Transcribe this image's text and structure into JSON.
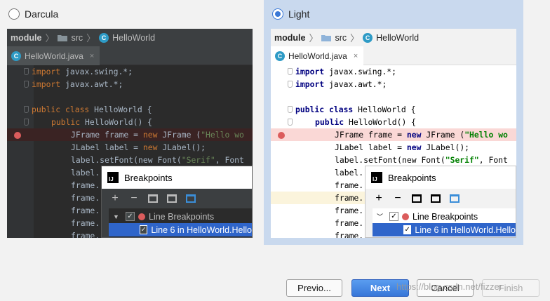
{
  "themes": [
    {
      "label": "Darcula",
      "selected": false
    },
    {
      "label": "Light",
      "selected": true
    }
  ],
  "breadcrumb": {
    "module": "module",
    "src": "src",
    "file": "HelloWorld"
  },
  "tab": {
    "filename": "HelloWorld.java",
    "close": "×"
  },
  "code_lines": [
    "import javax.swing.*;",
    "import javax.awt.*;",
    "",
    "public class HelloWorld {",
    "    public HelloWorld() {",
    "        JFrame frame = new JFrame (\"Hello wo",
    "        JLabel label = new JLabel();",
    "        label.setFont(new Font(\"Serif\", Font",
    "        label.",
    "        frame.",
    "        frame.",
    "        frame.",
    "        frame.",
    "        frame."
  ],
  "breakpoints_dialog": {
    "title": "Breakpoints",
    "group": "Line Breakpoints",
    "item": "Line 6 in HelloWorld.Hello",
    "icon_text": "IJ"
  },
  "buttons": {
    "previous": "Previo...",
    "next": "Next",
    "cancel": "Cancel",
    "finish": "Finish"
  },
  "watermark": "https://blog.csdn.net/fizzer"
}
